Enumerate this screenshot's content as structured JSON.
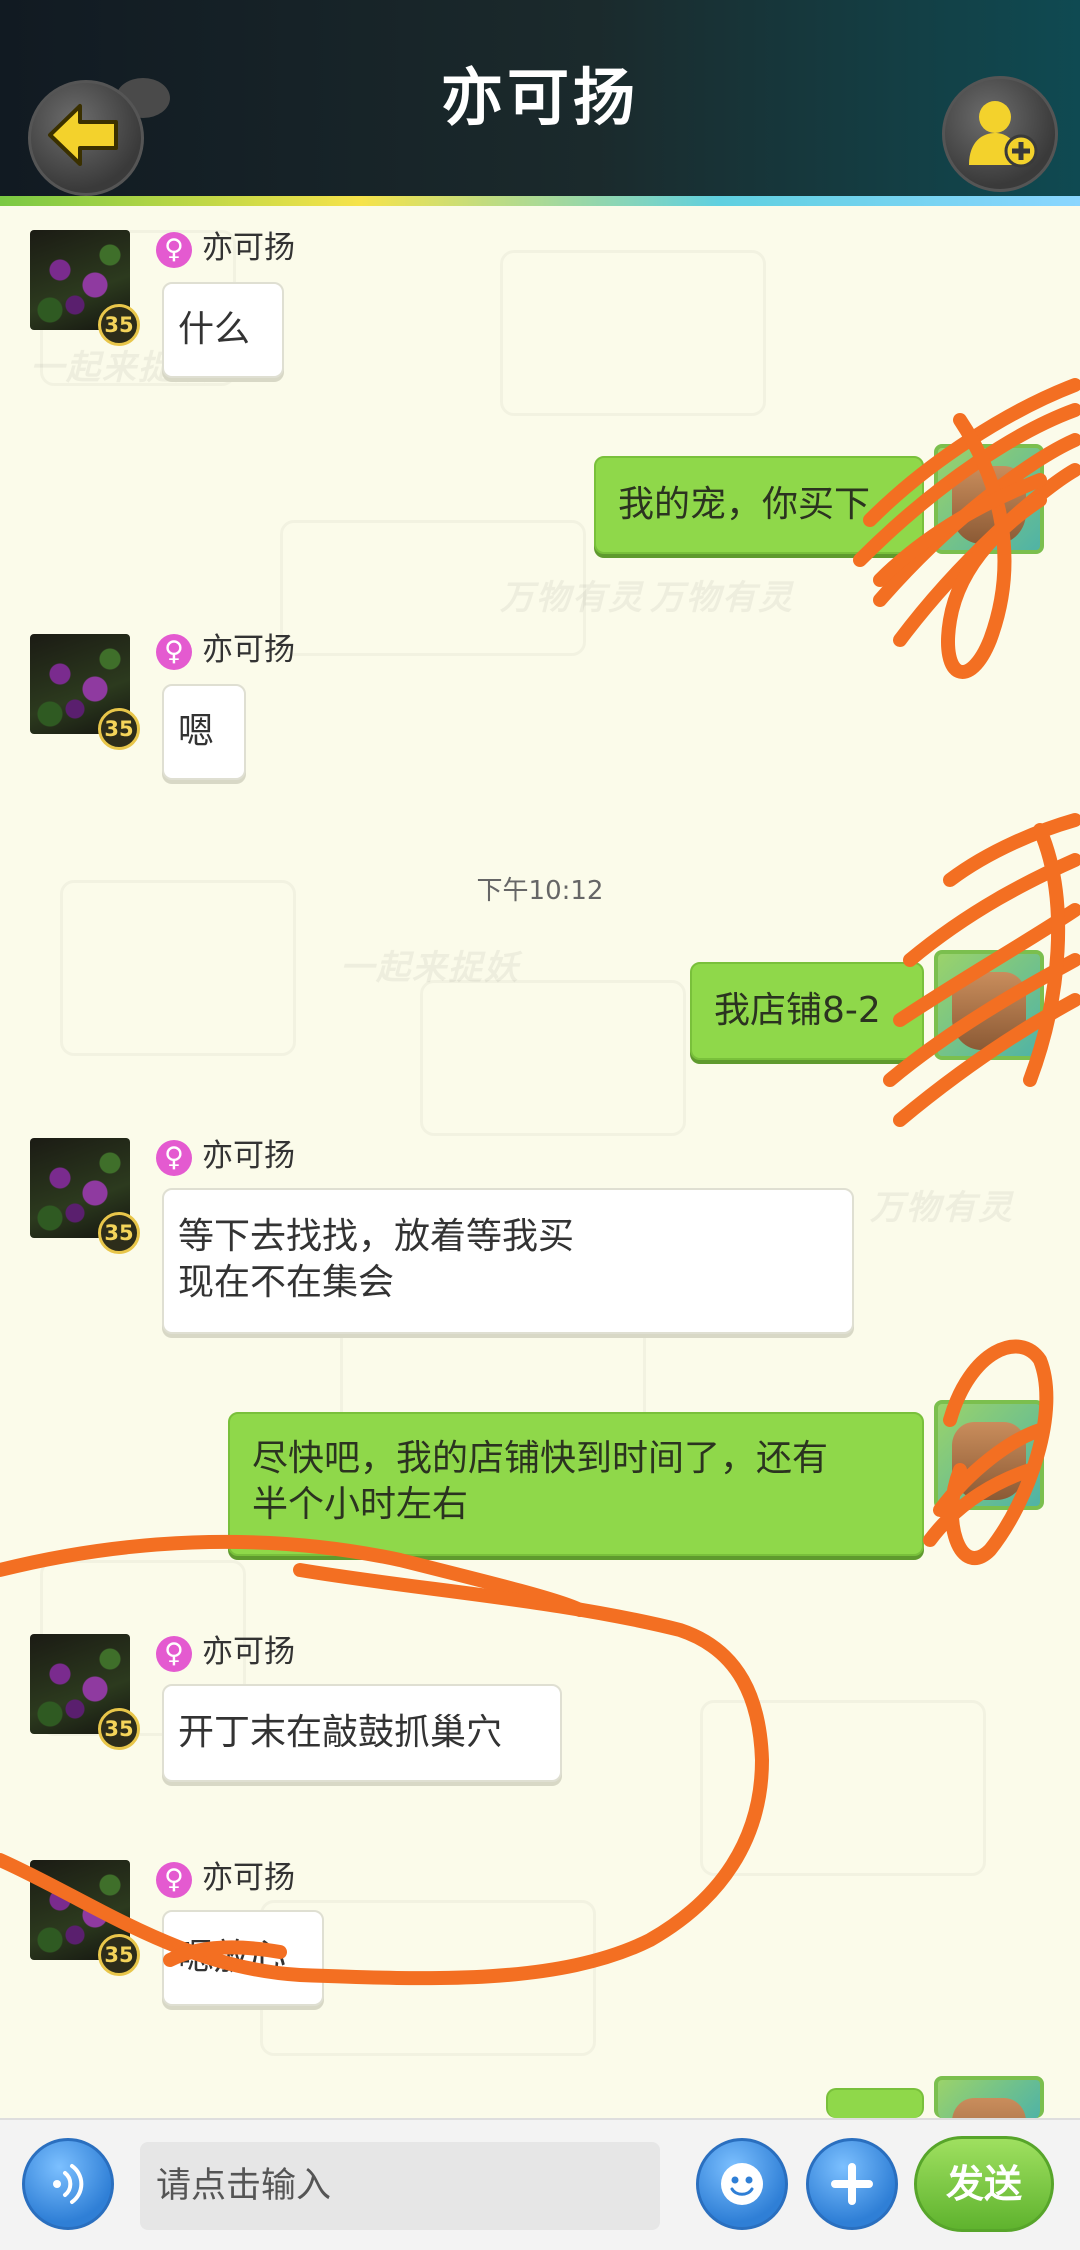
{
  "header": {
    "title": "亦可扬",
    "back_icon": "arrow-left-icon",
    "add_friend_icon": "add-friend-icon"
  },
  "messages": [
    {
      "direction": "in",
      "sender": "亦可扬",
      "level": "35",
      "text": "什么"
    },
    {
      "direction": "out",
      "text": "我的宠，你买下"
    },
    {
      "direction": "in",
      "sender": "亦可扬",
      "level": "35",
      "text": "嗯"
    },
    {
      "direction": "out",
      "text": "我店铺8-2"
    },
    {
      "direction": "in",
      "sender": "亦可扬",
      "level": "35",
      "text": "等下去找找，放着等我买\n现在不在集会"
    },
    {
      "direction": "out",
      "text": "尽快吧，我的店铺快到时间了，还有\n半个小时左右"
    },
    {
      "direction": "in",
      "sender": "亦可扬",
      "level": "35",
      "text": "开丁末在敲鼓抓巢穴"
    },
    {
      "direction": "in",
      "sender": "亦可扬",
      "level": "35",
      "text": "嗯放心"
    }
  ],
  "timestamp": "下午10:12",
  "input_bar": {
    "placeholder": "请点击输入",
    "send_label": "发送",
    "voice_icon": "voice-icon",
    "emoji_icon": "emoji-icon",
    "plus_icon": "plus-icon"
  },
  "colors": {
    "header_bg": "#111a22",
    "outgoing_bubble": "#8fd84a",
    "incoming_bubble": "#ffffff",
    "scribble": "#f36f22",
    "send_button": "#5fb32e"
  },
  "background_watermarks": [
    "万物有灵",
    "一起来捉妖"
  ]
}
